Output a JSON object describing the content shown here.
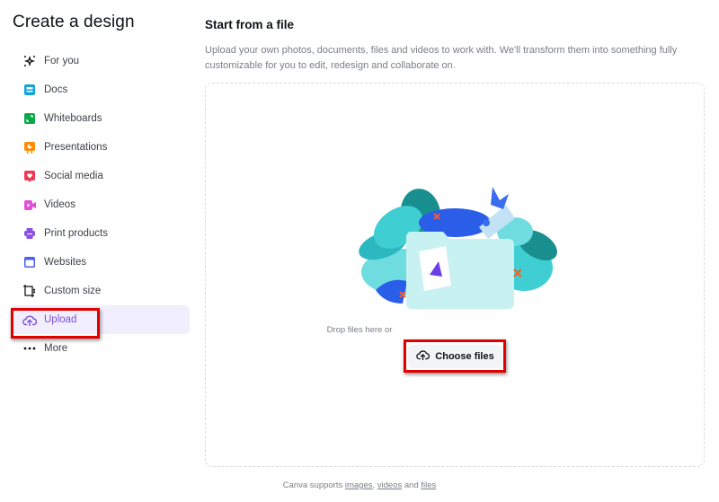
{
  "sidebar": {
    "title": "Create a design",
    "items": [
      {
        "label": "For you",
        "icon": "sparkle-icon",
        "color": "#0d1216"
      },
      {
        "label": "Docs",
        "icon": "docs-icon",
        "color": "#13a3d9"
      },
      {
        "label": "Whiteboards",
        "icon": "whiteboard-icon",
        "color": "#0ba84a"
      },
      {
        "label": "Presentations",
        "icon": "presentation-icon",
        "color": "#ff8a00"
      },
      {
        "label": "Social media",
        "icon": "heart-icon",
        "color": "#f0384f"
      },
      {
        "label": "Videos",
        "icon": "video-icon",
        "color": "#e04fd6"
      },
      {
        "label": "Print products",
        "icon": "printer-icon",
        "color": "#8b4fe8"
      },
      {
        "label": "Websites",
        "icon": "browser-icon",
        "color": "#4a5ef0"
      },
      {
        "label": "Custom size",
        "icon": "custom-size-icon",
        "color": "#0d1216"
      },
      {
        "label": "Upload",
        "icon": "cloud-upload-icon",
        "color": "#7d4fe0",
        "active": true
      },
      {
        "label": "More",
        "icon": "more-dots-icon",
        "color": "#0d1216"
      }
    ]
  },
  "main": {
    "heading": "Start from a file",
    "description": "Upload your own photos, documents, files and videos to work with. We'll transform them into something fully customizable for you to edit, redesign and collaborate on.",
    "dropzone": {
      "drop_text": "Drop files here or",
      "choose_label": "Choose files"
    },
    "footer": {
      "prefix": "Canva supports ",
      "link_images": "images",
      "sep1": ", ",
      "link_videos": "videos",
      "sep2": " and ",
      "link_files": "files"
    }
  },
  "colors": {
    "accent": "#7d4fe0",
    "active_bg": "#f1eefe",
    "highlight": "#e00000"
  }
}
